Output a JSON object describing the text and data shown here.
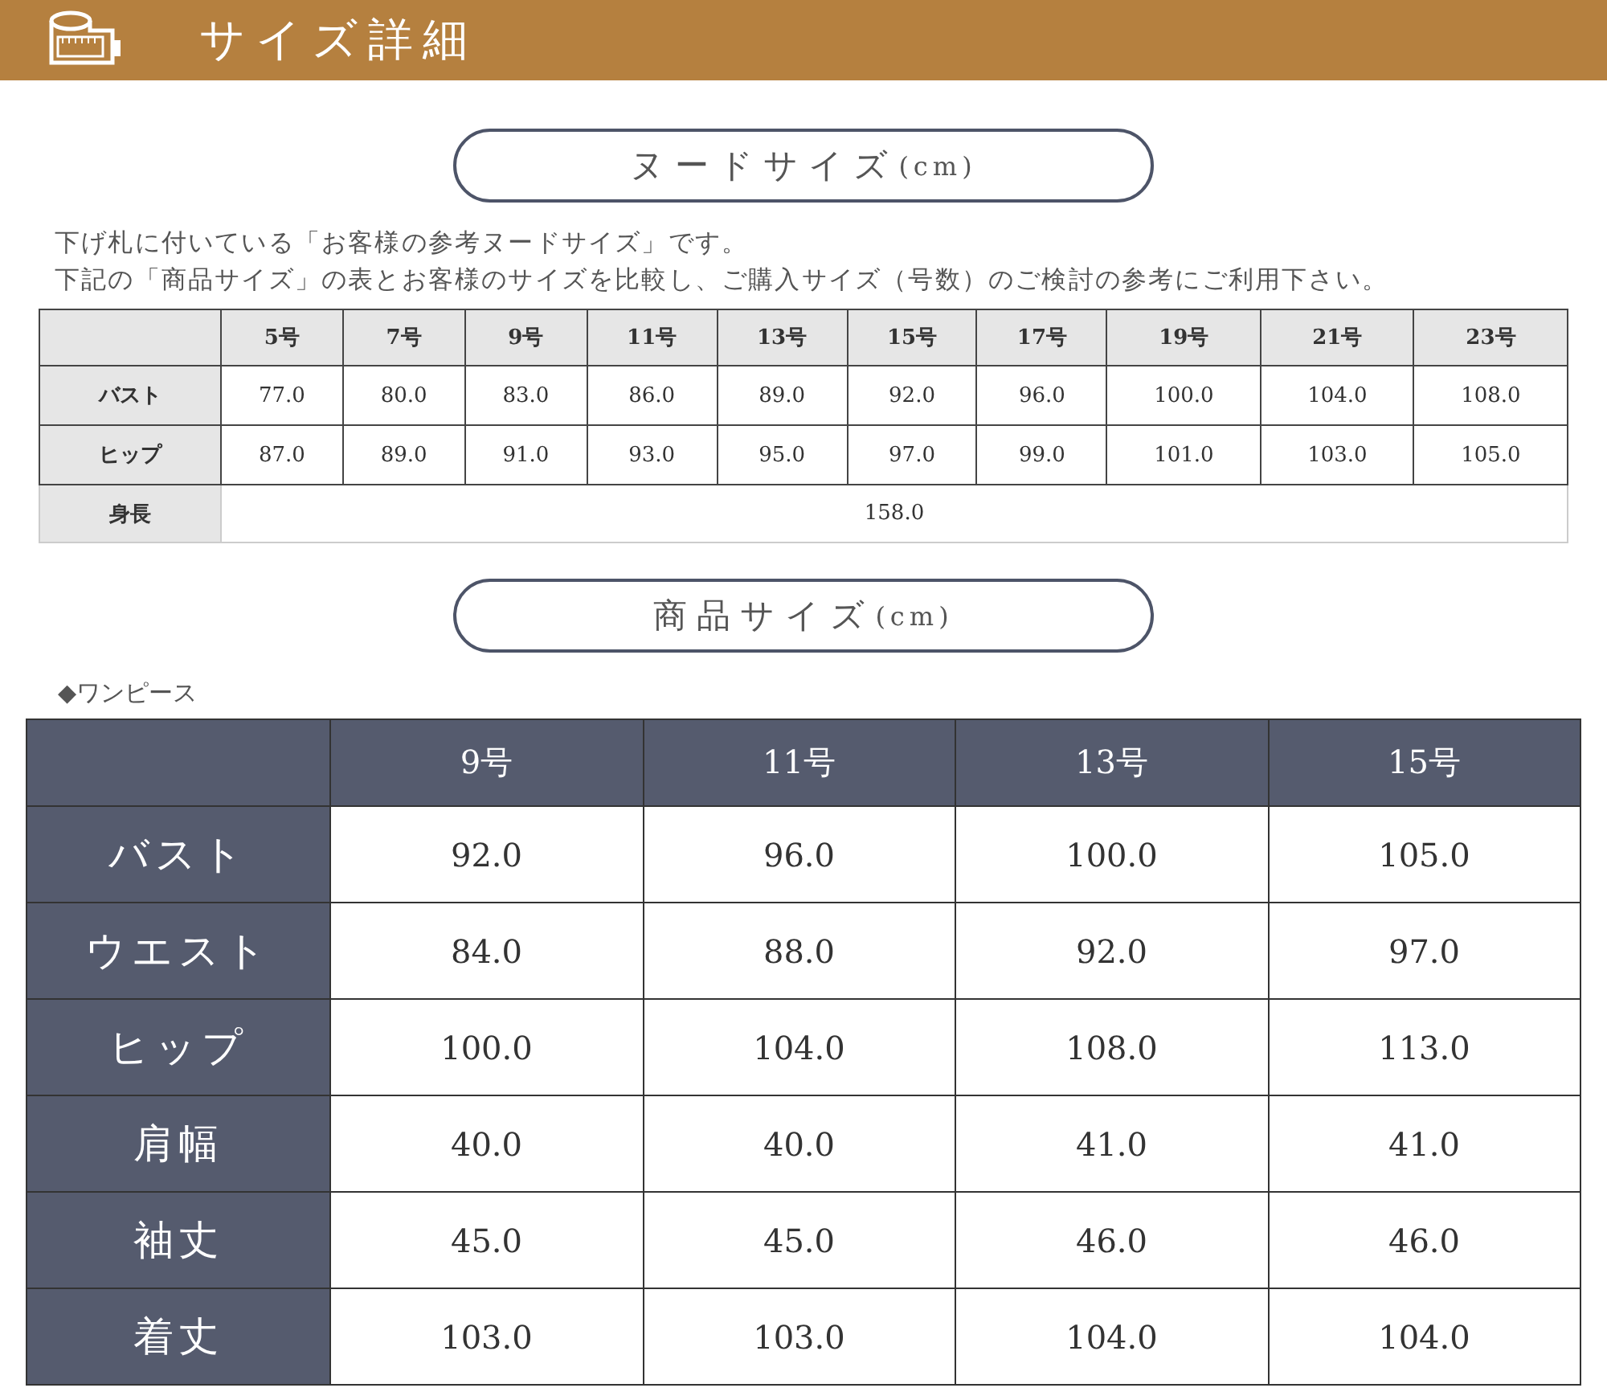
{
  "header": {
    "title": "サイズ詳細"
  },
  "nude_section": {
    "title": "ヌードサイズ",
    "unit": "(cm)",
    "notes": [
      "下げ札に付いている「お客様の参考ヌードサイズ」です。",
      "下記の「商品サイズ」の表とお客様のサイズを比較し、ご購入サイズ（号数）のご検討の参考にご利用下さい。"
    ],
    "columns": [
      "5号",
      "7号",
      "9号",
      "11号",
      "13号",
      "15号",
      "17号",
      "19号",
      "21号",
      "23号"
    ],
    "rows": [
      {
        "label": "バスト",
        "values": [
          "77.0",
          "80.0",
          "83.0",
          "86.0",
          "89.0",
          "92.0",
          "96.0",
          "100.0",
          "104.0",
          "108.0"
        ]
      },
      {
        "label": "ヒップ",
        "values": [
          "87.0",
          "89.0",
          "91.0",
          "93.0",
          "95.0",
          "97.0",
          "99.0",
          "101.0",
          "103.0",
          "105.0"
        ]
      }
    ],
    "height_row": {
      "label": "身長",
      "value": "158.0"
    }
  },
  "product_section": {
    "title": "商品サイズ",
    "unit": "(cm)",
    "category": "◆ワンピース",
    "columns": [
      "9号",
      "11号",
      "13号",
      "15号"
    ],
    "rows": [
      {
        "label": "バスト",
        "values": [
          "92.0",
          "96.0",
          "100.0",
          "105.0"
        ]
      },
      {
        "label": "ウエスト",
        "values": [
          "84.0",
          "88.0",
          "92.0",
          "97.0"
        ]
      },
      {
        "label": "ヒップ",
        "values": [
          "100.0",
          "104.0",
          "108.0",
          "113.0"
        ]
      },
      {
        "label": "肩幅",
        "values": [
          "40.0",
          "40.0",
          "41.0",
          "41.0"
        ]
      },
      {
        "label": "袖丈",
        "values": [
          "45.0",
          "45.0",
          "46.0",
          "46.0"
        ]
      },
      {
        "label": "着丈",
        "values": [
          "103.0",
          "103.0",
          "104.0",
          "104.0"
        ]
      }
    ]
  }
}
